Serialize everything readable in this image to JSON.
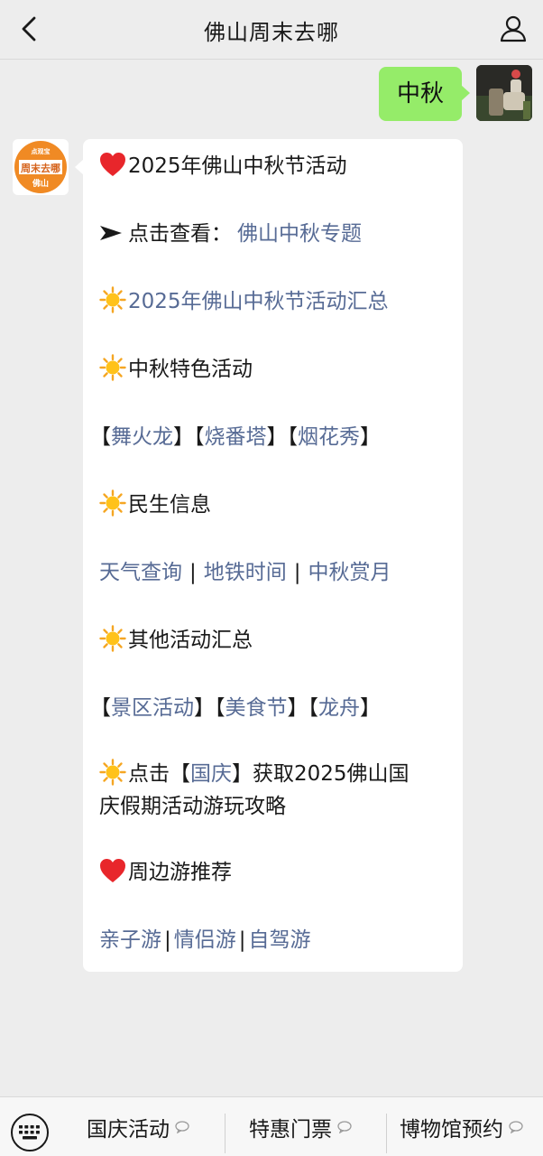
{
  "header": {
    "title": "佛山周末去哪",
    "back_icon": "chevron-left-icon",
    "profile_icon": "person-icon"
  },
  "user_message": {
    "text": "中秋"
  },
  "bot_avatar": {
    "logo_top": "点观宝",
    "logo_main": "周末去哪",
    "logo_bottom": "佛山",
    "accent": "#f08a24"
  },
  "bot_message": {
    "title": "2025年佛山中秋节活动",
    "click_view_label": "点击查看：",
    "click_view_link": "佛山中秋专题",
    "summary_link": "2025年佛山中秋节活动汇总",
    "featured_heading": "中秋特色活动",
    "featured_links": [
      "舞火龙",
      "烧番塔",
      "烟花秀"
    ],
    "livelihood_heading": "民生信息",
    "livelihood_links": [
      "天气查询",
      "地铁时间",
      "中秋赏月"
    ],
    "other_heading": "其他活动汇总",
    "other_links": [
      "景区活动",
      "美食节",
      "龙舟"
    ],
    "national_prefix": "点击【",
    "national_link": "国庆",
    "national_suffix_1": "】获取2025佛山国",
    "national_suffix_2": "庆假期活动游玩攻略",
    "nearby_heading": "周边游推荐",
    "nearby_links": [
      "亲子游",
      "情侣游",
      "自驾游"
    ]
  },
  "bottom_menu": {
    "keyboard_icon": "keyboard-icon",
    "items": [
      "国庆活动",
      "特惠门票",
      "博物馆预约"
    ]
  },
  "colors": {
    "background": "#ededed",
    "user_bubble": "#95ec69",
    "link": "#576b95"
  }
}
